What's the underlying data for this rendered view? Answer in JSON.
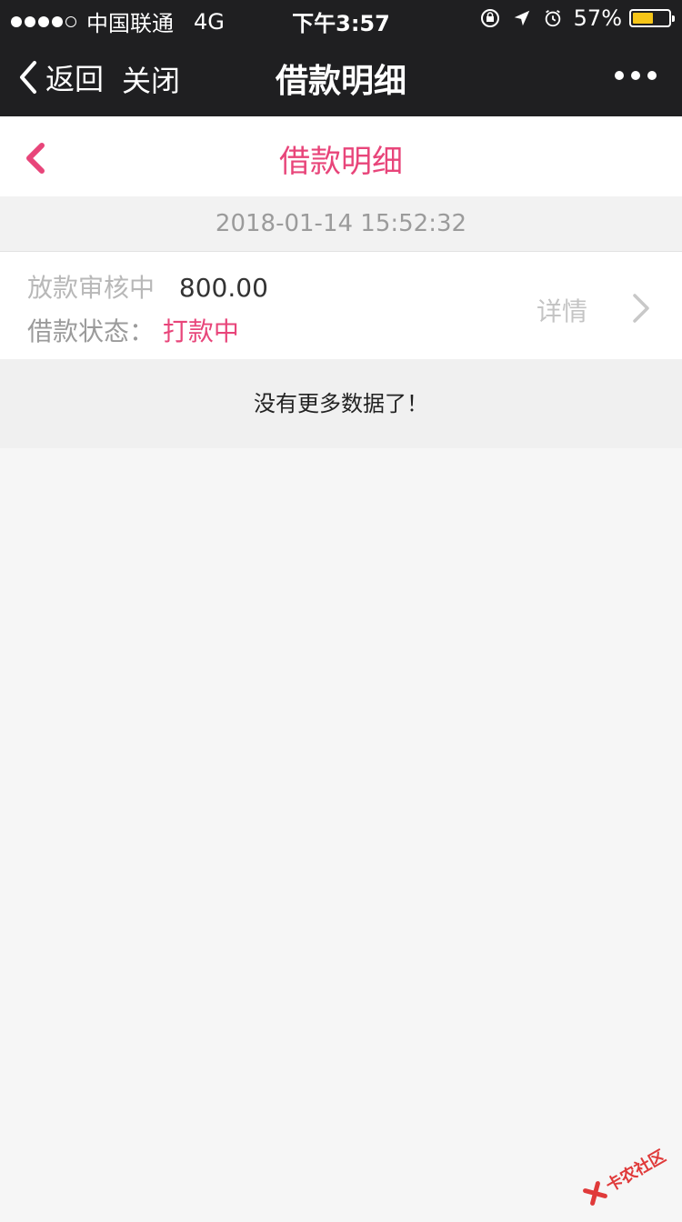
{
  "status_bar": {
    "carrier": "中国联通",
    "network": "4G",
    "time": "下午3:57",
    "battery_pct": "57%",
    "battery_level": 0.57,
    "battery_color": "#f5c518"
  },
  "wechat_nav": {
    "back_label": "返回",
    "close_label": "关闭",
    "title": "借款明细",
    "more_icon": "more-dots-icon"
  },
  "page_header": {
    "title": "借款明细",
    "accent_color": "#e8457a"
  },
  "record": {
    "date": "2018-01-14 15:52:32",
    "status_label": "放款审核中",
    "amount": "800.00",
    "loan_status_label": "借款状态：",
    "loan_status_value": "打款中",
    "detail_label": "详情"
  },
  "list_footer": {
    "message": "没有更多数据了！"
  },
  "watermark": {
    "text": "卡农社区"
  }
}
